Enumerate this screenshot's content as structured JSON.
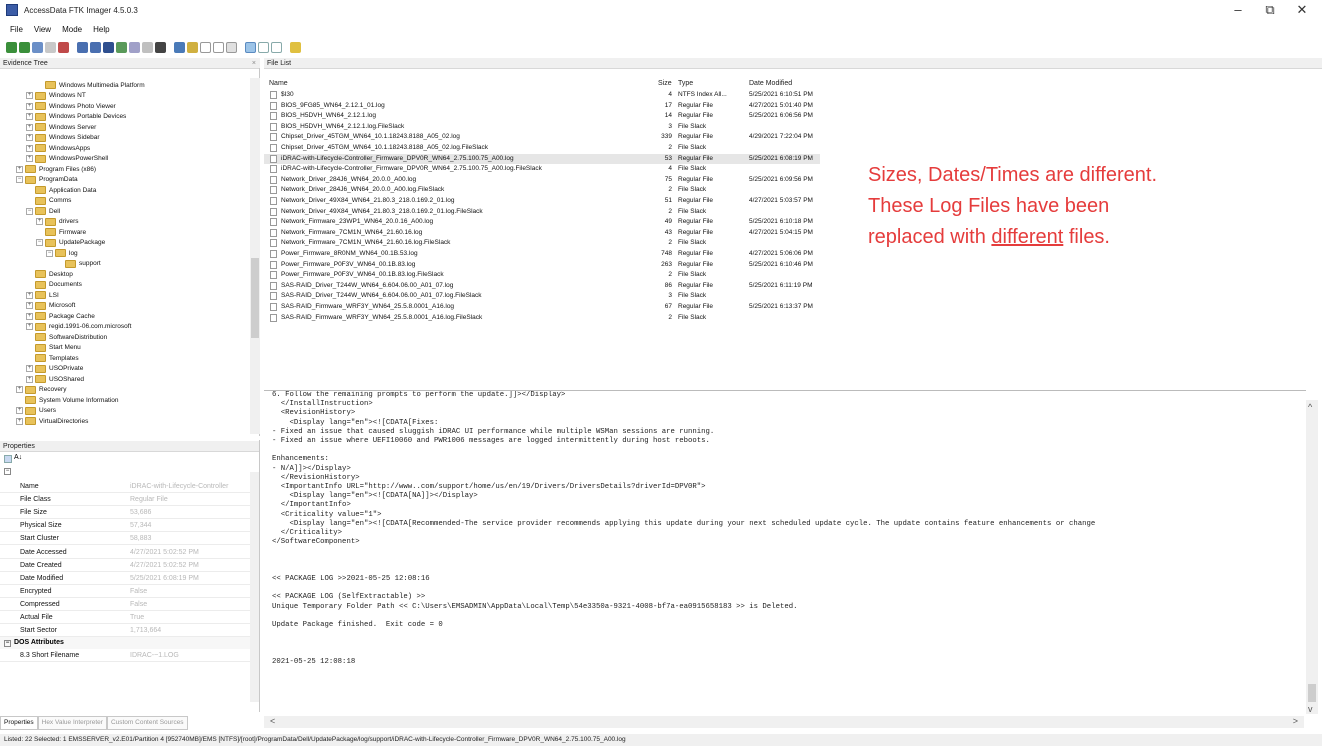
{
  "window": {
    "title": "AccessData FTK Imager 4.5.0.3",
    "controls": [
      "–",
      "⧉",
      "✕"
    ]
  },
  "menu": [
    "File",
    "View",
    "Mode",
    "Help"
  ],
  "panels": {
    "evidence_tree": "Evidence Tree",
    "file_list": "File List",
    "properties": "Properties"
  },
  "tree": [
    {
      "label": "Windows Multimedia Platform",
      "indent": 3,
      "exp": ""
    },
    {
      "label": "Windows NT",
      "indent": 2,
      "exp": "+"
    },
    {
      "label": "Windows Photo Viewer",
      "indent": 2,
      "exp": "+"
    },
    {
      "label": "Windows Portable Devices",
      "indent": 2,
      "exp": "+"
    },
    {
      "label": "Windows Server",
      "indent": 2,
      "exp": "+"
    },
    {
      "label": "Windows Sidebar",
      "indent": 2,
      "exp": "+"
    },
    {
      "label": "WindowsApps",
      "indent": 2,
      "exp": "+"
    },
    {
      "label": "WindowsPowerShell",
      "indent": 2,
      "exp": "+"
    },
    {
      "label": "Program Files (x86)",
      "indent": 1,
      "exp": "+"
    },
    {
      "label": "ProgramData",
      "indent": 1,
      "exp": "-"
    },
    {
      "label": "Application Data",
      "indent": 2,
      "exp": ""
    },
    {
      "label": "Comms",
      "indent": 2,
      "exp": ""
    },
    {
      "label": "Dell",
      "indent": 2,
      "exp": "-"
    },
    {
      "label": "drivers",
      "indent": 3,
      "exp": "+"
    },
    {
      "label": "Firmware",
      "indent": 3,
      "exp": ""
    },
    {
      "label": "UpdatePackage",
      "indent": 3,
      "exp": "-"
    },
    {
      "label": "log",
      "indent": 4,
      "exp": "-"
    },
    {
      "label": "support",
      "indent": 5,
      "exp": ""
    },
    {
      "label": "Desktop",
      "indent": 2,
      "exp": ""
    },
    {
      "label": "Documents",
      "indent": 2,
      "exp": ""
    },
    {
      "label": "LSI",
      "indent": 2,
      "exp": "+"
    },
    {
      "label": "Microsoft",
      "indent": 2,
      "exp": "+"
    },
    {
      "label": "Package Cache",
      "indent": 2,
      "exp": "+"
    },
    {
      "label": "regid.1991-06.com.microsoft",
      "indent": 2,
      "exp": "+"
    },
    {
      "label": "SoftwareDistribution",
      "indent": 2,
      "exp": ""
    },
    {
      "label": "Start Menu",
      "indent": 2,
      "exp": ""
    },
    {
      "label": "Templates",
      "indent": 2,
      "exp": ""
    },
    {
      "label": "USOPrivate",
      "indent": 2,
      "exp": "+"
    },
    {
      "label": "USOShared",
      "indent": 2,
      "exp": "+"
    },
    {
      "label": "Recovery",
      "indent": 1,
      "exp": "+"
    },
    {
      "label": "System Volume Information",
      "indent": 1,
      "exp": ""
    },
    {
      "label": "Users",
      "indent": 1,
      "exp": "+"
    },
    {
      "label": "VirtualDirectories",
      "indent": 1,
      "exp": "+"
    }
  ],
  "file_list": {
    "columns": {
      "name": "Name",
      "size": "Size",
      "type": "Type",
      "date": "Date Modified"
    },
    "rows": [
      {
        "name": "$I30",
        "size": "4",
        "type": "NTFS Index All...",
        "date": "5/25/2021 6:10:51 PM",
        "selected": false
      },
      {
        "name": "BIOS_9FG85_WN64_2.12.1_01.log",
        "size": "17",
        "type": "Regular File",
        "date": "4/27/2021 5:01:40 PM",
        "selected": false
      },
      {
        "name": "BIOS_H5DVH_WN64_2.12.1.log",
        "size": "14",
        "type": "Regular File",
        "date": "5/25/2021 6:06:56 PM",
        "selected": false
      },
      {
        "name": "BIOS_H5DVH_WN64_2.12.1.log.FileSlack",
        "size": "3",
        "type": "File Slack",
        "date": "",
        "selected": false
      },
      {
        "name": "Chipset_Driver_45TGM_WN64_10.1.18243.8188_A05_02.log",
        "size": "339",
        "type": "Regular File",
        "date": "4/29/2021 7:22:04 PM",
        "selected": false
      },
      {
        "name": "Chipset_Driver_45TGM_WN64_10.1.18243.8188_A05_02.log.FileSlack",
        "size": "2",
        "type": "File Slack",
        "date": "",
        "selected": false
      },
      {
        "name": "iDRAC-with-Lifecycle-Controller_Firmware_DPV0R_WN64_2.75.100.75_A00.log",
        "size": "53",
        "type": "Regular File",
        "date": "5/25/2021 6:08:19 PM",
        "selected": true
      },
      {
        "name": "iDRAC-with-Lifecycle-Controller_Firmware_DPV0R_WN64_2.75.100.75_A00.log.FileSlack",
        "size": "4",
        "type": "File Slack",
        "date": "",
        "selected": false
      },
      {
        "name": "Network_Driver_284J6_WN64_20.0.0_A00.log",
        "size": "75",
        "type": "Regular File",
        "date": "5/25/2021 6:09:56 PM",
        "selected": false
      },
      {
        "name": "Network_Driver_284J6_WN64_20.0.0_A00.log.FileSlack",
        "size": "2",
        "type": "File Slack",
        "date": "",
        "selected": false
      },
      {
        "name": "Network_Driver_49X84_WN64_21.80.3_218.0.169.2_01.log",
        "size": "51",
        "type": "Regular File",
        "date": "4/27/2021 5:03:57 PM",
        "selected": false
      },
      {
        "name": "Network_Driver_49X84_WN64_21.80.3_218.0.169.2_01.log.FileSlack",
        "size": "2",
        "type": "File Slack",
        "date": "",
        "selected": false
      },
      {
        "name": "Network_Firmware_23WP1_WN64_20.0.16_A00.log",
        "size": "49",
        "type": "Regular File",
        "date": "5/25/2021 6:10:18 PM",
        "selected": false
      },
      {
        "name": "Network_Firmware_7CM1N_WN64_21.60.16.log",
        "size": "43",
        "type": "Regular File",
        "date": "4/27/2021 5:04:15 PM",
        "selected": false
      },
      {
        "name": "Network_Firmware_7CM1N_WN64_21.60.16.log.FileSlack",
        "size": "2",
        "type": "File Slack",
        "date": "",
        "selected": false
      },
      {
        "name": "Power_Firmware_8R0NM_WN64_00.1B.53.log",
        "size": "748",
        "type": "Regular File",
        "date": "4/27/2021 5:06:06 PM",
        "selected": false
      },
      {
        "name": "Power_Firmware_P0F3V_WN64_00.1B.83.log",
        "size": "263",
        "type": "Regular File",
        "date": "5/25/2021 6:10:46 PM",
        "selected": false
      },
      {
        "name": "Power_Firmware_P0F3V_WN64_00.1B.83.log.FileSlack",
        "size": "2",
        "type": "File Slack",
        "date": "",
        "selected": false
      },
      {
        "name": "SAS-RAID_Driver_T244W_WN64_6.604.06.00_A01_07.log",
        "size": "86",
        "type": "Regular File",
        "date": "5/25/2021 6:11:19 PM",
        "selected": false
      },
      {
        "name": "SAS-RAID_Driver_T244W_WN64_6.604.06.00_A01_07.log.FileSlack",
        "size": "3",
        "type": "File Slack",
        "date": "",
        "selected": false
      },
      {
        "name": "SAS-RAID_Firmware_WRF3Y_WN64_25.5.8.0001_A16.log",
        "size": "67",
        "type": "Regular File",
        "date": "5/25/2021 6:13:37 PM",
        "selected": false
      },
      {
        "name": "SAS-RAID_Firmware_WRF3Y_WN64_25.5.8.0001_A16.log.FileSlack",
        "size": "2",
        "type": "File Slack",
        "date": "",
        "selected": false
      }
    ]
  },
  "annotation": {
    "line1": "Sizes, Dates/Times are different.",
    "line2": "These Log Files have been",
    "line3_pre": "replaced with ",
    "line3_u": "different",
    "line3_post": " files."
  },
  "properties": {
    "rows": [
      {
        "key": "Name",
        "value": "iDRAC-with-Lifecycle-Controller"
      },
      {
        "key": "File Class",
        "value": "Regular File"
      },
      {
        "key": "File Size",
        "value": "53,686"
      },
      {
        "key": "Physical Size",
        "value": "57,344"
      },
      {
        "key": "Start Cluster",
        "value": "58,883"
      },
      {
        "key": "Date Accessed",
        "value": "4/27/2021 5:02:52 PM"
      },
      {
        "key": "Date Created",
        "value": "4/27/2021 5:02:52 PM"
      },
      {
        "key": "Date Modified",
        "value": "5/25/2021 6:08:19 PM"
      },
      {
        "key": "Encrypted",
        "value": "False"
      },
      {
        "key": "Compressed",
        "value": "False"
      },
      {
        "key": "Actual File",
        "value": "True"
      },
      {
        "key": "Start Sector",
        "value": "1,713,664"
      }
    ],
    "group": "DOS Attributes",
    "group_row": {
      "key": "8.3 Short Filename",
      "value": "IDRAC-~1.LOG"
    },
    "sort_icon": "A↓"
  },
  "bottom_tabs": [
    "Properties",
    "Hex Value Interpreter",
    "Custom Content Sources"
  ],
  "viewer_text": "6. Follow the remaining prompts to perform the update.]]></Display>\n  </InstallInstruction>\n  <RevisionHistory>\n    <Display lang=\"en\"><![CDATA[Fixes:\n- Fixed an issue that caused sluggish iDRAC UI performance while multiple WSMan sessions are running.\n- Fixed an issue where UEFI10060 and PWR1006 messages are logged intermittently during host reboots.\n\nEnhancements:\n- N/A]]></Display>\n  </RevisionHistory>\n  <ImportantInfo URL=\"http://www..com/support/home/us/en/19/Drivers/DriversDetails?driverId=DPV0R\">\n    <Display lang=\"en\"><![CDATA[NA]]></Display>\n  </ImportantInfo>\n  <Criticality value=\"1\">\n    <Display lang=\"en\"><![CDATA[Recommended-The service provider recommends applying this update during your next scheduled update cycle. The update contains feature enhancements or change\n  </Criticality>\n</SoftwareComponent>\n\n\n\n<< PACKAGE LOG >>2021-05-25 12:08:16\n\n<< PACKAGE LOG (SelfExtractable) >>\nUnique Temporary Folder Path << C:\\Users\\EMSADMIN\\AppData\\Local\\Temp\\54e3350a-9321-4008-bf7a-ea0915658183 >> is Deleted.\n\nUpdate Package finished.  Exit code = 0\n\n\n\n2021-05-25 12:08:18",
  "status_bar": "Listed: 22  Selected: 1   EMSSERVER_v2.E01/Partition 4 [952740MB]/EMS [NTFS]/[root]/ProgramData/Dell/UpdatePackage/log/support/iDRAC-with-Lifecycle-Controller_Firmware_DPV0R_WN64_2.75.100.75_A00.log",
  "colors": {
    "annotation": "#e53c3c",
    "folder": "#e8c25a",
    "selection": "#e6e6e6"
  }
}
